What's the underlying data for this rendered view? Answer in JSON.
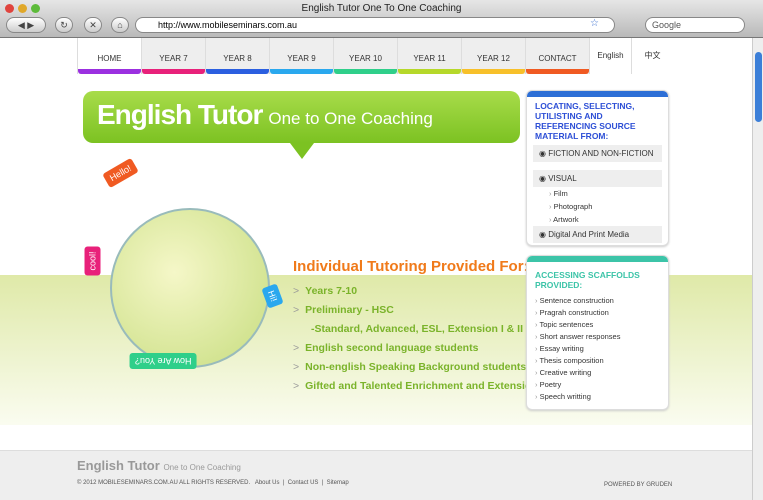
{
  "window": {
    "title": "English Tutor One To One Coaching",
    "url": "http://www.mobileseminars.com.au",
    "search_placeholder": "Google"
  },
  "nav": {
    "items": [
      {
        "label": "HOME",
        "color": "#9b30e0"
      },
      {
        "label": "YEAR 7",
        "color": "#e8217a"
      },
      {
        "label": "YEAR 8",
        "color": "#2b5fe0"
      },
      {
        "label": "YEAR 9",
        "color": "#2aa8ee"
      },
      {
        "label": "YEAR 10",
        "color": "#2fcf8a"
      },
      {
        "label": "YEAR 11",
        "color": "#b6d82a"
      },
      {
        "label": "YEAR 12",
        "color": "#f7c02a"
      },
      {
        "label": "CONTACT",
        "color": "#f05a22"
      }
    ],
    "lang": [
      "English",
      "中文"
    ]
  },
  "hero": {
    "title": "English Tutor",
    "subtitle": "One to One Coaching"
  },
  "stickers": [
    "Hello!",
    "cool!",
    "Hi!",
    "How Are You?"
  ],
  "tutoring": {
    "heading": "Individual Tutoring Provided For:",
    "items": [
      "Years 7-10",
      "Preliminary - HSC",
      "-Standard, Advanced, ESL, Extension I & II",
      "English second language students",
      "Non-english Speaking Background students",
      "Gifted and Talented Enrichment and Extension"
    ]
  },
  "box1": {
    "title": "LOCATING, SELECTING, UTILISTING AND REFERENCING SOURCE MATERIAL FROM:",
    "color": "#2d6fd6",
    "row1": "FICTION AND NON-FICTION",
    "row2": "VISUAL",
    "subs": [
      "Film",
      "Photograph",
      "Artwork"
    ],
    "row3": "Digital  And  Print  Media"
  },
  "box2": {
    "title": "ACCESSING SCAFFOLDS PROVIDED:",
    "color": "#3cc4a8",
    "items": [
      "Sentence construction",
      "Pragrah construction",
      "Topic sentences",
      "Short answer responses",
      "Essay writing",
      "Thesis composition",
      "Creative writing",
      "Poetry",
      "Speech writting"
    ]
  },
  "footer": {
    "logo": "English Tutor",
    "logo_sub": "One to One Coaching",
    "copyright": "© 2012 MOBILESEMINARS.COM.AU ALL RIGHTS RESERVED.",
    "links": [
      "About Us",
      "Contact US",
      "Sitemap"
    ],
    "powered": "POWERED BY GRUDEN"
  }
}
